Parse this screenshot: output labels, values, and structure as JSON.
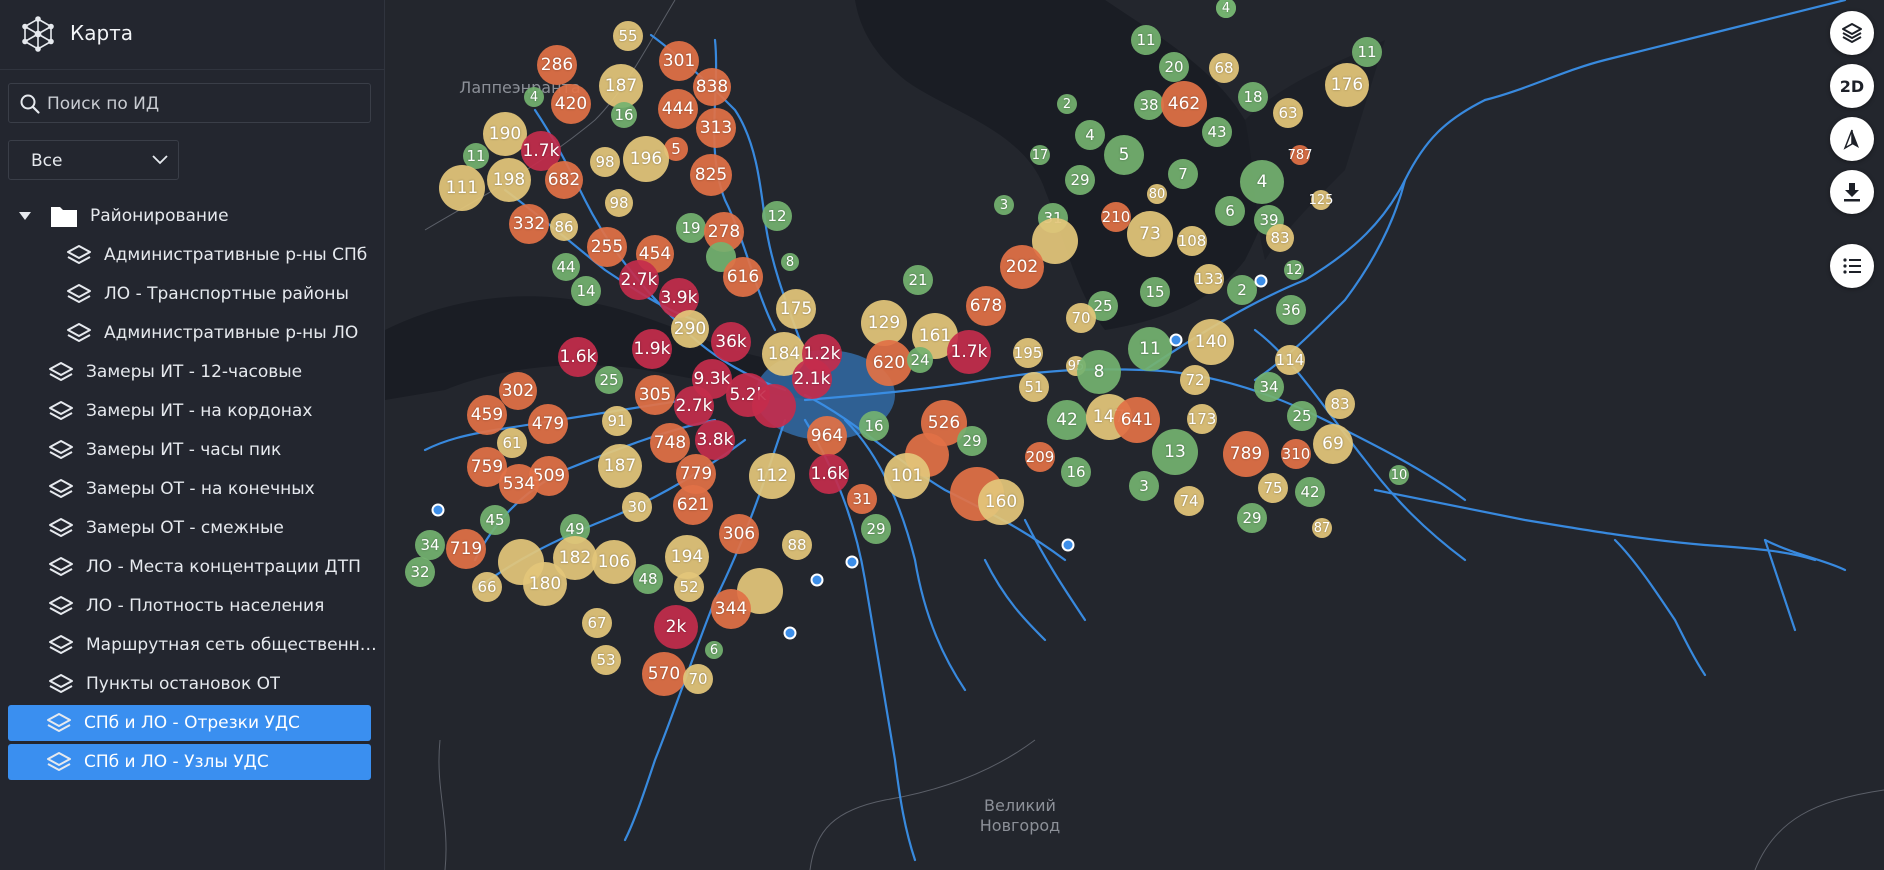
{
  "app": {
    "title": "Карта"
  },
  "search": {
    "placeholder": "Поиск по ИД"
  },
  "filter": {
    "selected": "Все"
  },
  "tree": {
    "group_label": "Районирование",
    "sub_items": [
      {
        "label": "Административные р-ны СПб"
      },
      {
        "label": "ЛО - Транспортные районы"
      },
      {
        "label": "Административные р-ны ЛО"
      }
    ],
    "items": [
      {
        "label": "Замеры ИТ - 12-часовые",
        "selected": false
      },
      {
        "label": "Замеры ИТ - на кордонах",
        "selected": false
      },
      {
        "label": "Замеры ИТ - часы пик",
        "selected": false
      },
      {
        "label": "Замеры ОТ - на конечных",
        "selected": false
      },
      {
        "label": "Замеры ОТ - смежные",
        "selected": false
      },
      {
        "label": "ЛО - Места концентрации ДТП",
        "selected": false
      },
      {
        "label": "ЛО - Плотность населения",
        "selected": false
      },
      {
        "label": "Маршрутная сеть общественно...",
        "selected": false
      },
      {
        "label": "Пункты остановок ОТ",
        "selected": false
      },
      {
        "label": "СПб и ЛО - Отрезки УДС",
        "selected": true
      },
      {
        "label": "СПб и ЛО - Узлы УДС",
        "selected": true
      }
    ]
  },
  "map": {
    "city_labels": [
      "Лаппеэнранта",
      "Великий\nНовгород"
    ],
    "clusters": [
      {
        "label": "55",
        "c": "yellow"
      },
      {
        "label": "301",
        "c": "orange"
      },
      {
        "label": "286",
        "c": "orange"
      },
      {
        "label": "187",
        "c": "yellow"
      },
      {
        "label": "838",
        "c": "orange"
      },
      {
        "label": "4",
        "c": "green"
      },
      {
        "label": "420",
        "c": "orange"
      },
      {
        "label": "16",
        "c": "green"
      },
      {
        "label": "444",
        "c": "orange"
      },
      {
        "label": "313",
        "c": "orange"
      },
      {
        "label": "190",
        "c": "yellow"
      },
      {
        "label": "1.7k",
        "c": "red"
      },
      {
        "label": "5",
        "c": "orange"
      },
      {
        "label": "11",
        "c": "green"
      },
      {
        "label": "98",
        "c": "yellow"
      },
      {
        "label": "196",
        "c": "yellow"
      },
      {
        "label": "825",
        "c": "orange"
      },
      {
        "label": "111",
        "c": "yellow"
      },
      {
        "label": "198",
        "c": "yellow"
      },
      {
        "label": "682",
        "c": "orange"
      },
      {
        "label": "98",
        "c": "yellow"
      },
      {
        "label": "332",
        "c": "orange"
      },
      {
        "label": "86",
        "c": "yellow"
      },
      {
        "label": "255",
        "c": "orange"
      },
      {
        "label": "454",
        "c": "orange"
      },
      {
        "label": "19",
        "c": "green"
      },
      {
        "label": "278",
        "c": "orange"
      },
      {
        "label": "12",
        "c": "green"
      },
      {
        "label": "44",
        "c": "green"
      },
      {
        "label": "2.7k",
        "c": "red"
      },
      {
        "label": "",
        "c": "green"
      },
      {
        "label": "616",
        "c": "orange"
      },
      {
        "label": "8",
        "c": "green"
      },
      {
        "label": "14",
        "c": "green"
      },
      {
        "label": "3.9k",
        "c": "red"
      },
      {
        "label": "175",
        "c": "yellow"
      },
      {
        "label": "290",
        "c": "yellow"
      },
      {
        "label": "36k",
        "c": "red"
      },
      {
        "label": "1.6k",
        "c": "red"
      },
      {
        "label": "1.9k",
        "c": "red"
      },
      {
        "label": "184",
        "c": "yellow"
      },
      {
        "label": "1.2k",
        "c": "red"
      },
      {
        "label": "25",
        "c": "green"
      },
      {
        "label": "9.3k",
        "c": "red"
      },
      {
        "label": "2.1k",
        "c": "red"
      },
      {
        "label": "302",
        "c": "orange"
      },
      {
        "label": "305",
        "c": "orange"
      },
      {
        "label": "5.2k",
        "c": "red"
      },
      {
        "label": "",
        "c": "red"
      },
      {
        "label": "2.7k",
        "c": "red"
      },
      {
        "label": "459",
        "c": "orange"
      },
      {
        "label": "479",
        "c": "orange"
      },
      {
        "label": "91",
        "c": "yellow"
      },
      {
        "label": "61",
        "c": "yellow"
      },
      {
        "label": "748",
        "c": "orange"
      },
      {
        "label": "3.8k",
        "c": "red"
      },
      {
        "label": "964",
        "c": "orange"
      },
      {
        "label": "187",
        "c": "yellow"
      },
      {
        "label": "759",
        "c": "orange"
      },
      {
        "label": "509",
        "c": "orange"
      },
      {
        "label": "779",
        "c": "orange"
      },
      {
        "label": "534",
        "c": "orange"
      },
      {
        "label": "112",
        "c": "yellow"
      },
      {
        "label": "1.6k",
        "c": "red"
      },
      {
        "label": "621",
        "c": "orange"
      },
      {
        "label": "30",
        "c": "yellow"
      },
      {
        "label": "45",
        "c": "green"
      },
      {
        "label": "49",
        "c": "green"
      },
      {
        "label": "306",
        "c": "orange"
      },
      {
        "label": "34",
        "c": "green"
      },
      {
        "label": "719",
        "c": "orange"
      },
      {
        "label": "",
        "c": "yellow"
      },
      {
        "label": "182",
        "c": "yellow"
      },
      {
        "label": "106",
        "c": "yellow"
      },
      {
        "label": "194",
        "c": "yellow"
      },
      {
        "label": "88",
        "c": "yellow"
      },
      {
        "label": "32",
        "c": "green"
      },
      {
        "label": "180",
        "c": "yellow"
      },
      {
        "label": "66",
        "c": "yellow"
      },
      {
        "label": "48",
        "c": "green"
      },
      {
        "label": "52",
        "c": "yellow"
      },
      {
        "label": "",
        "c": "yellow"
      },
      {
        "label": "344",
        "c": "orange"
      },
      {
        "label": "67",
        "c": "yellow"
      },
      {
        "label": "2k",
        "c": "red"
      },
      {
        "label": "6",
        "c": "green"
      },
      {
        "label": "53",
        "c": "yellow"
      },
      {
        "label": "570",
        "c": "orange"
      },
      {
        "label": "70",
        "c": "yellow"
      },
      {
        "label": "129",
        "c": "yellow"
      },
      {
        "label": "161",
        "c": "yellow"
      },
      {
        "label": "678",
        "c": "orange"
      },
      {
        "label": "620",
        "c": "orange"
      },
      {
        "label": "24",
        "c": "green"
      },
      {
        "label": "1.7k",
        "c": "red"
      },
      {
        "label": "21",
        "c": "green"
      },
      {
        "label": "16",
        "c": "green"
      },
      {
        "label": "526",
        "c": "orange"
      },
      {
        "label": "",
        "c": "orange"
      },
      {
        "label": "29",
        "c": "green"
      },
      {
        "label": "101",
        "c": "yellow"
      },
      {
        "label": "31",
        "c": "orange"
      },
      {
        "label": "29",
        "c": "green"
      },
      {
        "label": "",
        "c": "orange"
      },
      {
        "label": "160",
        "c": "yellow"
      },
      {
        "label": "5",
        "c": "green"
      },
      {
        "label": "11",
        "c": "green"
      },
      {
        "label": "20",
        "c": "green"
      },
      {
        "label": "68",
        "c": "yellow"
      },
      {
        "label": "11",
        "c": "green"
      },
      {
        "label": "176",
        "c": "yellow"
      },
      {
        "label": "2",
        "c": "green"
      },
      {
        "label": "38",
        "c": "green"
      },
      {
        "label": "462",
        "c": "orange"
      },
      {
        "label": "18",
        "c": "green"
      },
      {
        "label": "63",
        "c": "yellow"
      },
      {
        "label": "4",
        "c": "green"
      },
      {
        "label": "43",
        "c": "green"
      },
      {
        "label": "17",
        "c": "green"
      },
      {
        "label": "5",
        "c": "green"
      },
      {
        "label": "787",
        "c": "orange"
      },
      {
        "label": "7",
        "c": "green"
      },
      {
        "label": "29",
        "c": "green"
      },
      {
        "label": "80",
        "c": "yellow"
      },
      {
        "label": "4",
        "c": "green"
      },
      {
        "label": "125",
        "c": "yellow"
      },
      {
        "label": "3",
        "c": "green"
      },
      {
        "label": "6",
        "c": "green"
      },
      {
        "label": "39",
        "c": "green"
      },
      {
        "label": "31",
        "c": "green"
      },
      {
        "label": "210",
        "c": "orange"
      },
      {
        "label": "73",
        "c": "yellow"
      },
      {
        "label": "108",
        "c": "yellow"
      },
      {
        "label": "83",
        "c": "yellow"
      },
      {
        "label": "",
        "c": "yellow"
      },
      {
        "label": "202",
        "c": "orange"
      },
      {
        "label": "133",
        "c": "yellow"
      },
      {
        "label": "12",
        "c": "green"
      },
      {
        "label": "2",
        "c": "green"
      },
      {
        "label": "15",
        "c": "green"
      },
      {
        "label": "25",
        "c": "green"
      },
      {
        "label": "70",
        "c": "yellow"
      },
      {
        "label": "36",
        "c": "green"
      },
      {
        "label": "11",
        "c": "green"
      },
      {
        "label": "140",
        "c": "yellow"
      },
      {
        "label": "195",
        "c": "yellow"
      },
      {
        "label": "95",
        "c": "yellow"
      },
      {
        "label": "8",
        "c": "green"
      },
      {
        "label": "114",
        "c": "yellow"
      },
      {
        "label": "51",
        "c": "yellow"
      },
      {
        "label": "72",
        "c": "yellow"
      },
      {
        "label": "34",
        "c": "green"
      },
      {
        "label": "42",
        "c": "green"
      },
      {
        "label": "147",
        "c": "yellow"
      },
      {
        "label": "641",
        "c": "orange"
      },
      {
        "label": "173",
        "c": "yellow"
      },
      {
        "label": "83",
        "c": "yellow"
      },
      {
        "label": "25",
        "c": "green"
      },
      {
        "label": "13",
        "c": "green"
      },
      {
        "label": "789",
        "c": "orange"
      },
      {
        "label": "310",
        "c": "orange"
      },
      {
        "label": "69",
        "c": "yellow"
      },
      {
        "label": "209",
        "c": "orange"
      },
      {
        "label": "16",
        "c": "green"
      },
      {
        "label": "10",
        "c": "green"
      },
      {
        "label": "3",
        "c": "green"
      },
      {
        "label": "74",
        "c": "yellow"
      },
      {
        "label": "75",
        "c": "yellow"
      },
      {
        "label": "42",
        "c": "green"
      },
      {
        "label": "29",
        "c": "green"
      },
      {
        "label": "87",
        "c": "yellow"
      },
      {
        "label": "4",
        "c": "green"
      },
      {
        "label": "5",
        "c": "green"
      }
    ],
    "controls": [
      {
        "name": "layers-button",
        "icon": "layers-icon",
        "text": ""
      },
      {
        "name": "view-mode-button",
        "icon": "",
        "text": "2D"
      },
      {
        "name": "compass-button",
        "icon": "compass-icon",
        "text": ""
      },
      {
        "name": "download-button",
        "icon": "download-icon",
        "text": ""
      },
      {
        "name": "legend-button",
        "icon": "list-icon",
        "text": ""
      }
    ]
  }
}
